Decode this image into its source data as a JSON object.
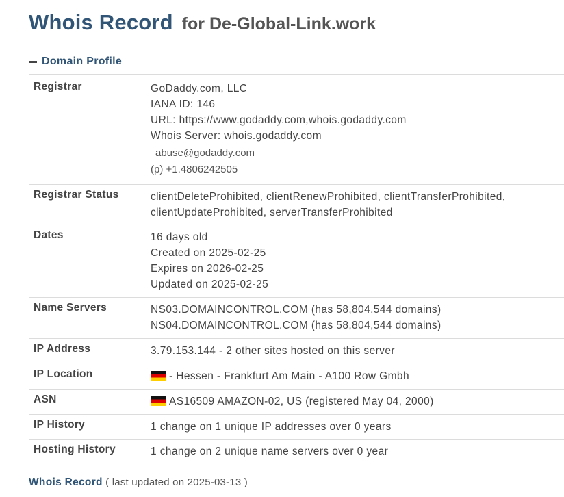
{
  "page": {
    "title": "Whois Record",
    "subtitle": "for De-Global-Link.work"
  },
  "section": {
    "label": "Domain Profile",
    "icon": "minus-icon"
  },
  "rows": {
    "registrar": {
      "label": "Registrar",
      "name": "GoDaddy.com, LLC",
      "iana": "IANA ID: 146",
      "url": "URL: https://www.godaddy.com,whois.godaddy.com",
      "whois_server": "Whois Server: whois.godaddy.com",
      "email": "abuse@godaddy.com",
      "phone": "(p)  +1.4806242505"
    },
    "registrar_status": {
      "label": "Registrar Status",
      "line1": "clientDeleteProhibited, clientRenewProhibited, clientTransferProhibited,",
      "line2": "clientUpdateProhibited, serverTransferProhibited"
    },
    "dates": {
      "label": "Dates",
      "age": "16 days old",
      "created": "Created on 2025-02-25",
      "expires": "Expires on 2026-02-25",
      "updated": "Updated on 2025-02-25"
    },
    "name_servers": {
      "label": "Name Servers",
      "ns1": "NS03.DOMAINCONTROL.COM (has 58,804,544 domains)",
      "ns2": "NS04.DOMAINCONTROL.COM (has 58,804,544 domains)"
    },
    "ip_address": {
      "label": "IP Address",
      "value": "3.79.153.144 - 2 other sites hosted on this server"
    },
    "ip_location": {
      "label": "IP Location",
      "flag": "germany-flag-icon",
      "value": "- Hessen - Frankfurt Am Main - A100 Row Gmbh"
    },
    "asn": {
      "label": "ASN",
      "flag": "germany-flag-icon",
      "value": "AS16509 AMAZON-02, US (registered May 04, 2000)"
    },
    "ip_history": {
      "label": "IP History",
      "value": "1 change on 1 unique IP addresses over 0 years"
    },
    "hosting_history": {
      "label": "Hosting History",
      "value": "1 change on 2 unique name servers over 0 year"
    }
  },
  "footer": {
    "link": "Whois Record",
    "updated": "( last updated on 2025-03-13 )"
  },
  "colors": {
    "accent": "#315576",
    "text": "#444444",
    "divider": "#dcdcdc"
  }
}
